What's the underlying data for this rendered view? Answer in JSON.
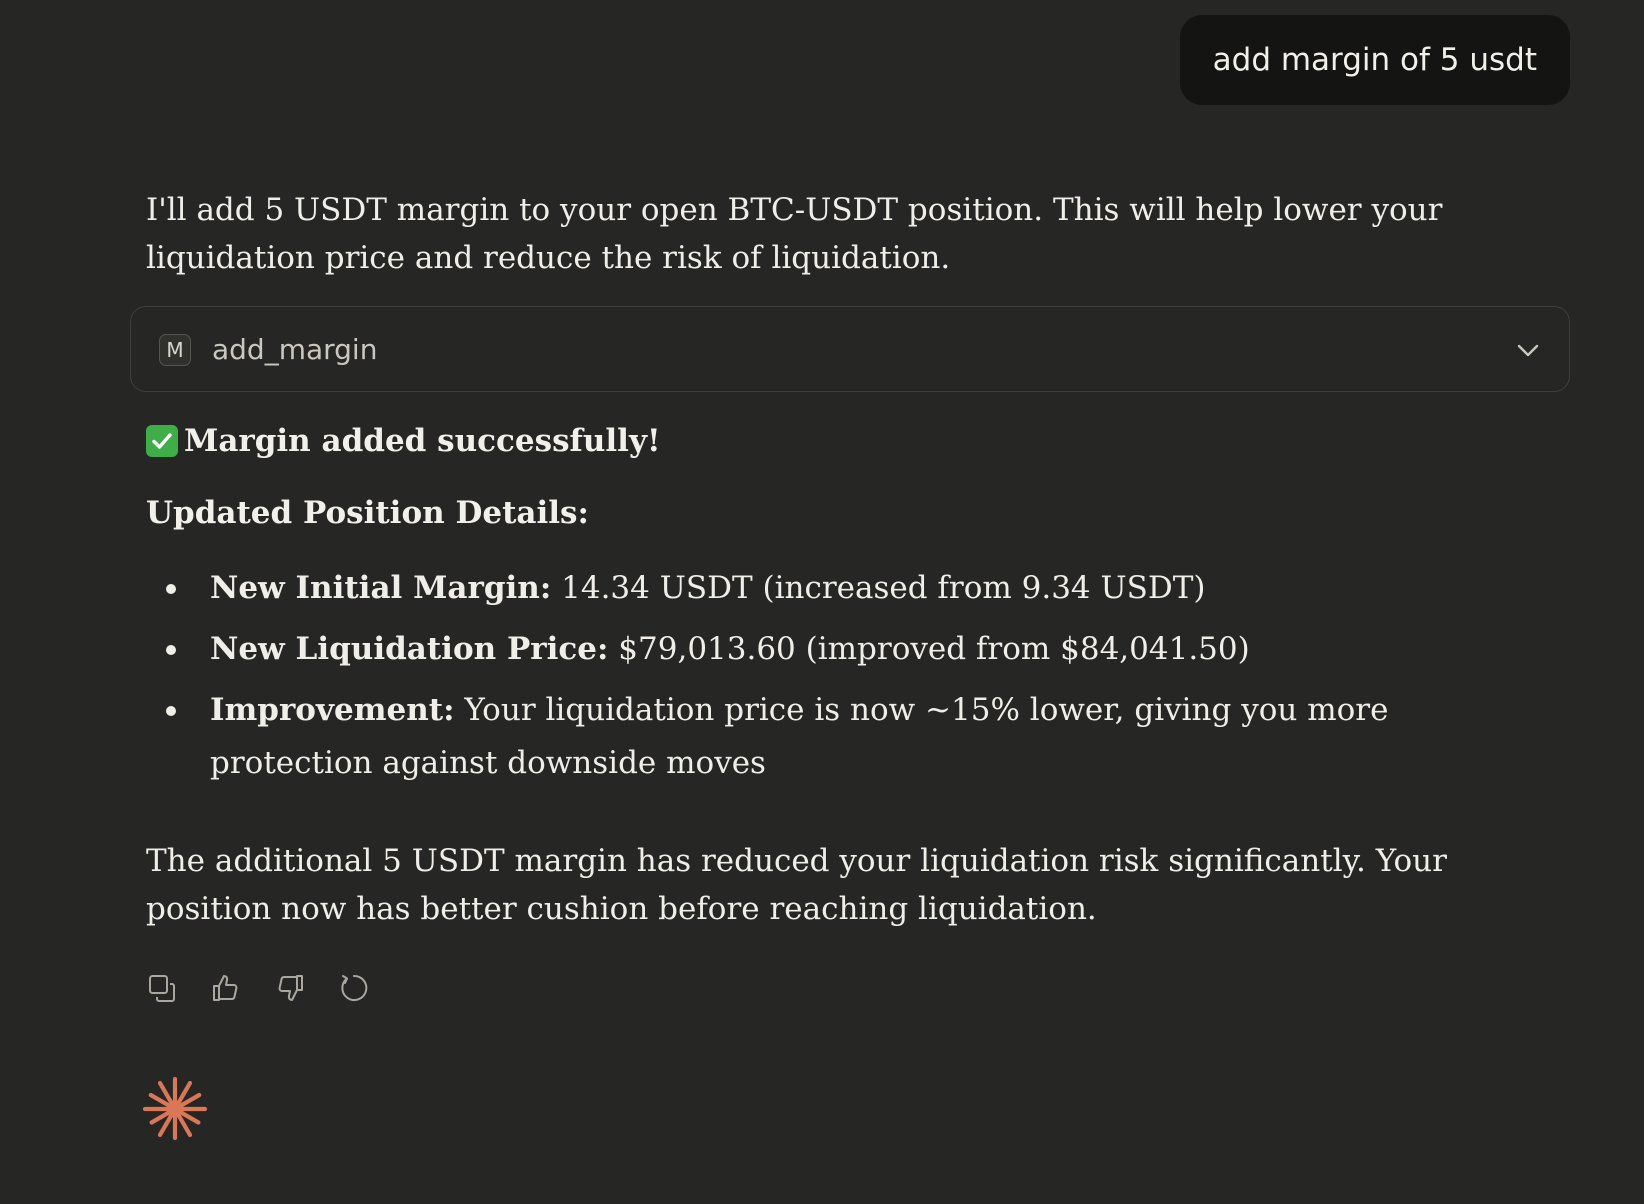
{
  "user_message": "add margin of 5 usdt",
  "assistant": {
    "intro": "I'll add 5 USDT margin to your open BTC-USDT position. This will help lower your liquidation price and reduce the risk of liquidation.",
    "tool_call": {
      "badge": "M",
      "name": "add_margin",
      "icon": "chevron-down-icon"
    },
    "success_icon": "check-mark-icon",
    "success_text": "Margin added successfully!",
    "details_heading": "Updated Position Details:",
    "details": [
      {
        "label": "New Initial Margin:",
        "text": " 14.34 USDT (increased from 9.34 USDT)"
      },
      {
        "label": "New Liquidation Price:",
        "text": " $79,013.60 (improved from $84,041.50)"
      },
      {
        "label": "Improvement:",
        "text": " Your liquidation price is now ~15% lower, giving you more protection against downside moves"
      }
    ],
    "outro": "The additional 5 USDT margin has reduced your liquidation risk significantly. Your position now has better cushion before reaching liquidation."
  },
  "actions": [
    "copy-icon",
    "thumbs-up-icon",
    "thumbs-down-icon",
    "retry-icon"
  ],
  "colors": {
    "background": "#262624",
    "user_bubble": "#141413",
    "accent": "#d97757",
    "success": "#3fae49"
  }
}
